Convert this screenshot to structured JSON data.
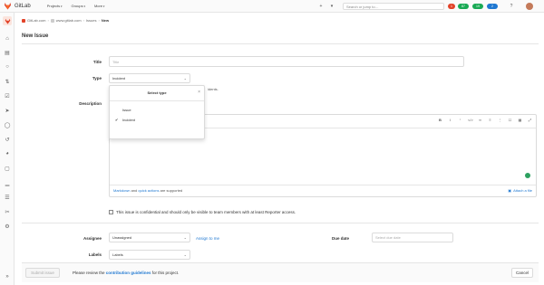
{
  "topbar": {
    "app_name": "GitLab",
    "nav": [
      "Projects",
      "Groups",
      "More"
    ],
    "search_placeholder": "Search or jump to…",
    "badges": [
      {
        "label": "1",
        "color": "#e24329"
      },
      {
        "label": "87",
        "color": "#1aaa55"
      },
      {
        "label": "19",
        "color": "#1aaa55"
      },
      {
        "label": "2",
        "color": "#1f78d1"
      }
    ],
    "accent": "#e24329"
  },
  "breadcrumb": {
    "items": [
      "GitLab.com",
      "www.gitlab.com",
      "Issues"
    ],
    "current": "New"
  },
  "page": {
    "title": "New Issue"
  },
  "form": {
    "title_label": "Title",
    "title_placeholder": "Title",
    "type_label": "Type",
    "type_value": "Incident",
    "type_hint": "idents.",
    "description_label": "Description",
    "editor_placeholder": "Write a comment or drag your files here…",
    "markdown_link": "Markdown",
    "and_text": " and ",
    "quick_actions_link": "quick actions",
    "supported_text": " are supported",
    "attach_label": "Attach a file",
    "confidential_text": "This issue is confidential and should only be visible to team members with at least Reporter access.",
    "assignee_label": "Assignee",
    "assignee_value": "Unassigned",
    "assign_to_me": "Assign to me",
    "due_date_label": "Due date",
    "due_date_placeholder": "Select due date",
    "labels_label": "Labels",
    "labels_value": "Labels"
  },
  "type_dropdown": {
    "title": "Select type",
    "options": [
      "Issue",
      "Incident"
    ],
    "selected": "Incident"
  },
  "footer": {
    "submit_label": "Submit issue",
    "note_prefix": "Please review the ",
    "note_link": "contribution guidelines",
    "note_suffix": " for this project.",
    "cancel_label": "Cancel"
  }
}
